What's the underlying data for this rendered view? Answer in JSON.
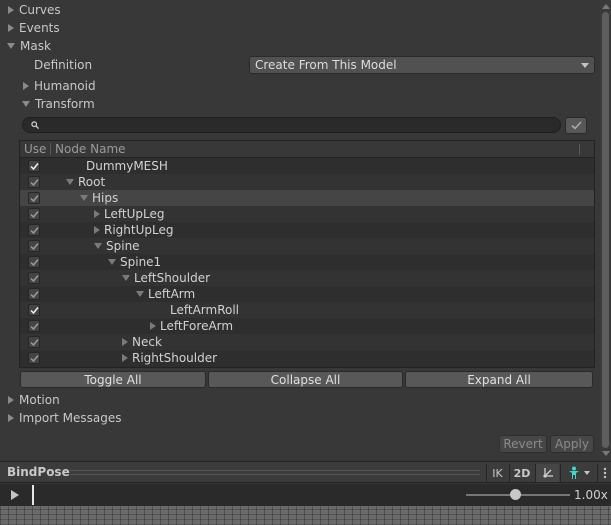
{
  "foldouts": {
    "curves": "Curves",
    "events": "Events",
    "mask": "Mask",
    "humanoid": "Humanoid",
    "transform": "Transform",
    "motion": "Motion",
    "import_messages": "Import Messages"
  },
  "definition": {
    "label": "Definition",
    "value": "Create From This Model"
  },
  "search": {
    "value": ""
  },
  "tree": {
    "col_use": "Use",
    "col_node": "Node Name",
    "rows": [
      {
        "name": "DummyMESH",
        "checked": true,
        "arrow": "none"
      },
      {
        "name": "Root",
        "checked": true,
        "arrow": "down"
      },
      {
        "name": "Hips",
        "checked": true,
        "arrow": "down"
      },
      {
        "name": "LeftUpLeg",
        "checked": true,
        "arrow": "right"
      },
      {
        "name": "RightUpLeg",
        "checked": true,
        "arrow": "right"
      },
      {
        "name": "Spine",
        "checked": true,
        "arrow": "down"
      },
      {
        "name": "Spine1",
        "checked": true,
        "arrow": "down"
      },
      {
        "name": "LeftShoulder",
        "checked": true,
        "arrow": "down"
      },
      {
        "name": "LeftArm",
        "checked": true,
        "arrow": "down"
      },
      {
        "name": "LeftArmRoll",
        "checked": true,
        "arrow": "none"
      },
      {
        "name": "LeftForeArm",
        "checked": true,
        "arrow": "right"
      },
      {
        "name": "Neck",
        "checked": true,
        "arrow": "right"
      },
      {
        "name": "RightShoulder",
        "checked": true,
        "arrow": "right"
      }
    ]
  },
  "buttons": {
    "toggle_all": "Toggle All",
    "collapse_all": "Collapse All",
    "expand_all": "Expand All",
    "revert": "Revert",
    "apply": "Apply"
  },
  "preview": {
    "label": "BindPose",
    "ik": "IK",
    "mode_2d": "2D",
    "speed": "1.00x"
  }
}
